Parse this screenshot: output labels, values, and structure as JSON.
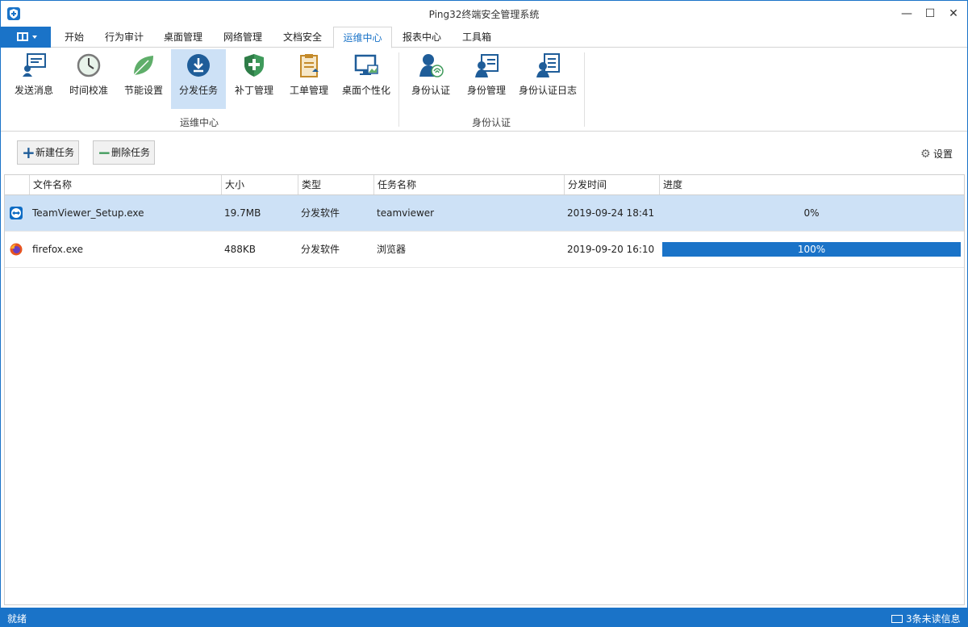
{
  "window": {
    "title": "Ping32终端安全管理系统",
    "minimize_glyph": "—",
    "maximize_glyph": "☐",
    "close_glyph": "✕"
  },
  "tabs": [
    {
      "label": "开始",
      "active": false
    },
    {
      "label": "行为审计",
      "active": false
    },
    {
      "label": "桌面管理",
      "active": false
    },
    {
      "label": "网络管理",
      "active": false
    },
    {
      "label": "文档安全",
      "active": false
    },
    {
      "label": "运维中心",
      "active": true
    },
    {
      "label": "报表中心",
      "active": false
    },
    {
      "label": "工具箱",
      "active": false
    }
  ],
  "ribbon": {
    "groups": [
      {
        "label": "运维中心"
      },
      {
        "label": "身份认证"
      }
    ],
    "buttons": [
      {
        "label": "发送消息",
        "icon": "message-icon",
        "selected": false
      },
      {
        "label": "时间校准",
        "icon": "clock-icon",
        "selected": false
      },
      {
        "label": "节能设置",
        "icon": "leaf-icon",
        "selected": false
      },
      {
        "label": "分发任务",
        "icon": "download-icon",
        "selected": true
      },
      {
        "label": "补丁管理",
        "icon": "shield-icon",
        "selected": false
      },
      {
        "label": "工单管理",
        "icon": "clipboard-icon",
        "selected": false
      },
      {
        "label": "桌面个性化",
        "icon": "monitor-icon",
        "selected": false
      },
      {
        "label": "身份认证",
        "icon": "fingerprint-user-icon",
        "selected": false
      },
      {
        "label": "身份管理",
        "icon": "user-list-icon",
        "selected": false
      },
      {
        "label": "身份认证日志",
        "icon": "user-log-icon",
        "selected": false
      }
    ]
  },
  "toolbar": {
    "new_task": "新建任务",
    "delete_task": "删除任务",
    "settings": "设置"
  },
  "grid": {
    "columns": [
      "文件名称",
      "大小",
      "类型",
      "任务名称",
      "分发时间",
      "进度"
    ],
    "rows": [
      {
        "file": "TeamViewer_Setup.exe",
        "icon": "teamviewer-icon",
        "size": "19.7MB",
        "type": "分发软件",
        "task": "teamviewer",
        "time": "2019-09-24 18:41",
        "progress": 0,
        "progress_text": "0%",
        "selected": true
      },
      {
        "file": "firefox.exe",
        "icon": "firefox-icon",
        "size": "488KB",
        "type": "分发软件",
        "task": "浏览器",
        "time": "2019-09-20 16:10",
        "progress": 1.0,
        "progress_text": "100%",
        "selected": false
      }
    ]
  },
  "status": {
    "left": "就绪",
    "right": "3条未读信息"
  },
  "colors": {
    "accent": "#1a73c8",
    "selection": "#cde1f6"
  }
}
